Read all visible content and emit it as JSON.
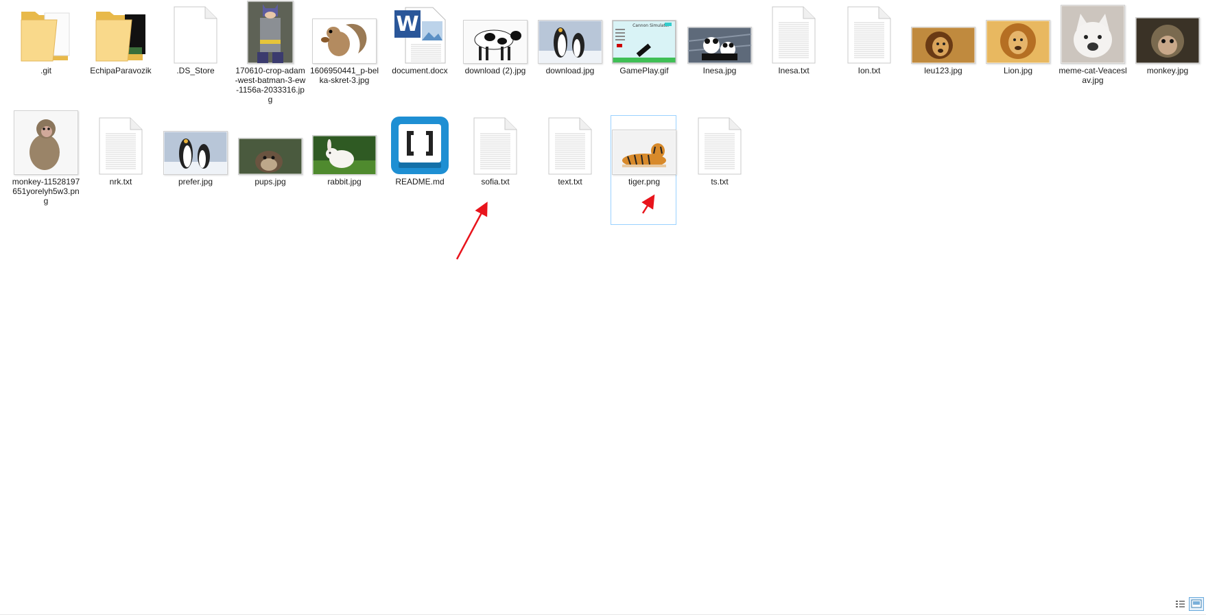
{
  "items": [
    {
      "name": ".git",
      "kind": "folder-icon"
    },
    {
      "name": "EchipaParavozik",
      "kind": "folder-icon"
    },
    {
      "name": ".DS_Store",
      "kind": "blank-file-icon"
    },
    {
      "name": "170610-crop-adam-west-batman-3-ew-1156a-2033316.jpg",
      "kind": "batman-photo-icon"
    },
    {
      "name": "1606950441_p-belka-skret-3.jpg",
      "kind": "squirrel-photo-icon"
    },
    {
      "name": "document.docx",
      "kind": "word-document-icon"
    },
    {
      "name": "download (2).jpg",
      "kind": "cow-photo-icon"
    },
    {
      "name": "download.jpg",
      "kind": "penguins-photo-icon"
    },
    {
      "name": "GamePlay.gif",
      "kind": "game-screenshot-icon",
      "preview_title": "Cannon Simulator"
    },
    {
      "name": "Inesa.jpg",
      "kind": "panda-photo-icon"
    },
    {
      "name": "Inesa.txt",
      "kind": "text-file-icon"
    },
    {
      "name": "Ion.txt",
      "kind": "text-file-icon"
    },
    {
      "name": "leu123.jpg",
      "kind": "lion-photo-icon"
    },
    {
      "name": "Lion.jpg",
      "kind": "lion-portrait-icon"
    },
    {
      "name": "meme-cat-Veaceslav.jpg",
      "kind": "cat-photo-icon"
    },
    {
      "name": "monkey.jpg",
      "kind": "monkey-photo-icon"
    },
    {
      "name": "monkey-11528197651yorelyh5w3.png",
      "kind": "monkey-sitting-icon"
    },
    {
      "name": "nrk.txt",
      "kind": "text-file-icon"
    },
    {
      "name": "prefer.jpg",
      "kind": "penguins-photo-icon"
    },
    {
      "name": "pups.jpg",
      "kind": "otter-photo-icon"
    },
    {
      "name": "rabbit.jpg",
      "kind": "rabbit-photo-icon"
    },
    {
      "name": "README.md",
      "kind": "brackets-app-icon"
    },
    {
      "name": "sofia.txt",
      "kind": "text-file-icon"
    },
    {
      "name": "text.txt",
      "kind": "text-file-icon"
    },
    {
      "name": "tiger.png",
      "kind": "tiger-photo-icon",
      "selected": true
    },
    {
      "name": "ts.txt",
      "kind": "text-file-icon"
    }
  ],
  "annotations": [
    {
      "kind": "red-arrow-icon",
      "color": "#e8141c",
      "points_to": "sofia.txt"
    },
    {
      "kind": "red-arrow-icon",
      "color": "#e8141c",
      "points_to": "tiger.png"
    }
  ],
  "view_buttons": [
    {
      "kind": "details-view-icon"
    },
    {
      "kind": "large-icons-view-icon",
      "active": true
    }
  ],
  "colors": {
    "selection_border": "#99d1ff",
    "folder": "#f6d27a",
    "arrow": "#e8141c"
  }
}
